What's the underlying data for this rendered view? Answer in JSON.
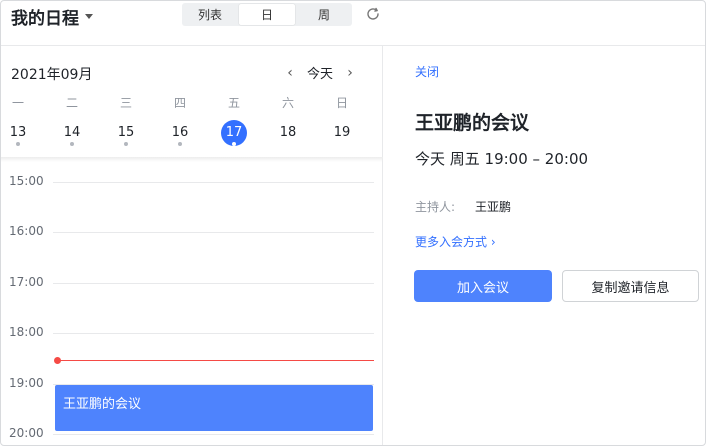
{
  "header": {
    "title": "我的日程",
    "view_tabs": [
      {
        "label": "列表",
        "active": false
      },
      {
        "label": "日",
        "active": true
      },
      {
        "label": "周",
        "active": false
      }
    ],
    "refresh_icon": "refresh-icon",
    "dropdown_icon": "caret-down-icon"
  },
  "calendar": {
    "month_label": "2021年09月",
    "today_label": "今天",
    "prev_icon": "chevron-left-icon",
    "next_icon": "chevron-right-icon",
    "weekdays": [
      "一",
      "二",
      "三",
      "四",
      "五",
      "六",
      "日"
    ],
    "dates": [
      "13",
      "14",
      "15",
      "16",
      "17",
      "18",
      "19"
    ],
    "today_index": 4,
    "has_event_dots": [
      true,
      true,
      true,
      true,
      true,
      false,
      false
    ],
    "hours": [
      "15:00",
      "16:00",
      "17:00",
      "18:00",
      "19:00",
      "20:00"
    ],
    "event_block": {
      "title": "王亚鹏的会议"
    }
  },
  "detail": {
    "close_label": "关闭",
    "title": "王亚鹏的会议",
    "time": "今天 周五 19:00 – 20:00",
    "host_label": "主持人:",
    "host_name": "王亚鹏",
    "more_link": "更多入会方式 ›",
    "join_button": "加入会议",
    "copy_button": "复制邀请信息"
  },
  "colors": {
    "accent": "#3370ff",
    "event_block": "#4e83fd",
    "now_indicator": "#f54a45"
  }
}
